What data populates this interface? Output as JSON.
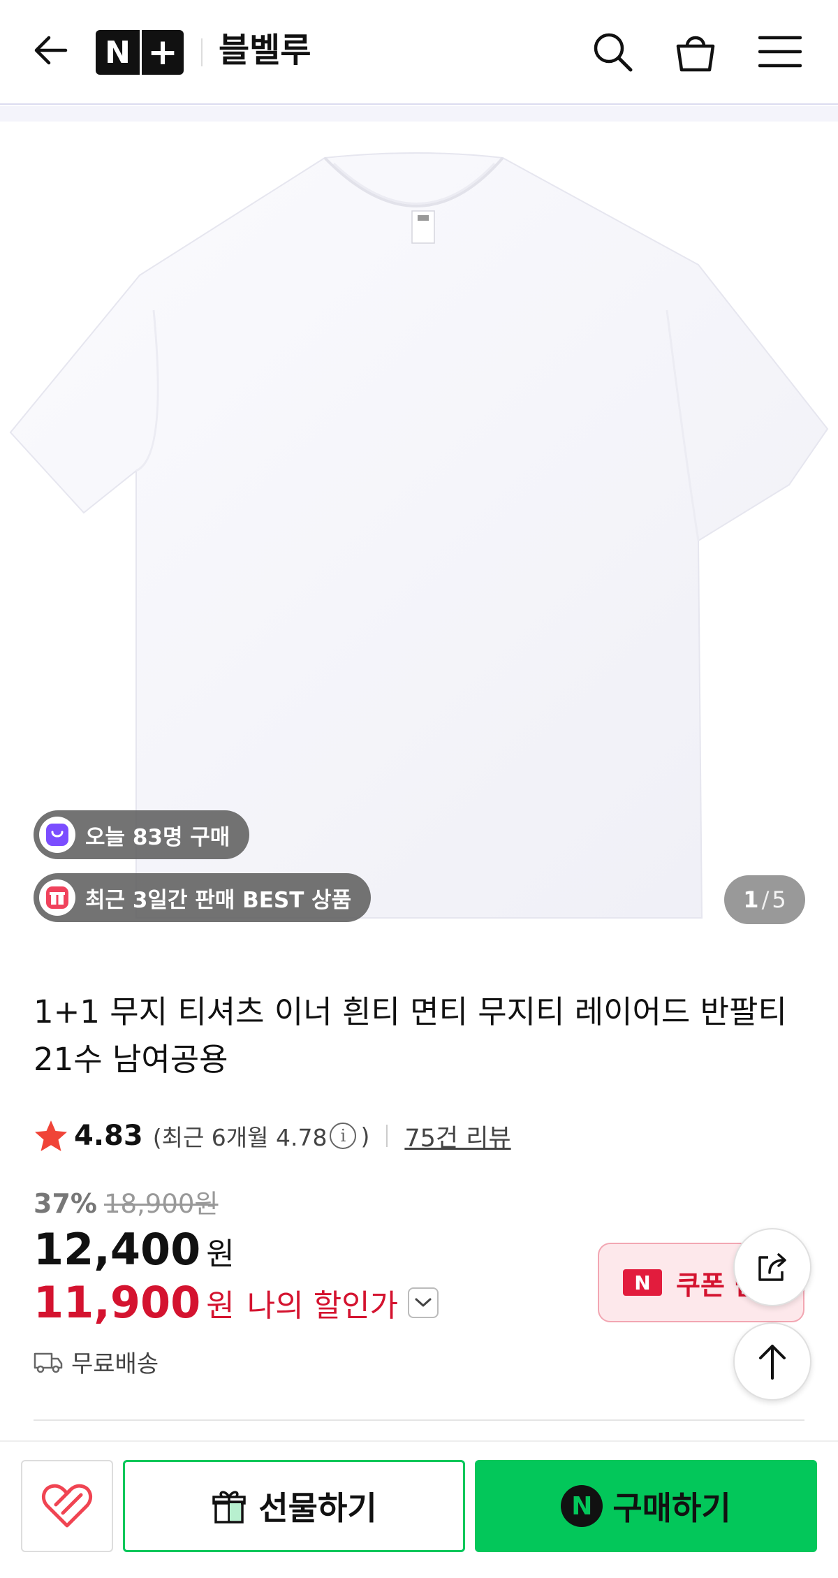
{
  "header": {
    "logo_text": "N+",
    "store_name": "블벨루"
  },
  "gallery": {
    "badges": [
      {
        "text": "오늘 83명 구매",
        "icon": "shopping-bag-icon"
      },
      {
        "text": "최근 3일간 판매 BEST 상품",
        "icon": "gift-box-icon"
      }
    ],
    "current_page": "1",
    "total_pages": "5"
  },
  "product": {
    "title": "1+1 무지 티셔츠 이너 흰티 면티 무지티 레이어드 반팔티 21수 남여공용",
    "rating": "4.83",
    "recent_rating_open": "(최근 6개월 4.78",
    "recent_rating_close": ")",
    "review_link": "75건 리뷰",
    "discount_rate": "37%",
    "original_price": "18,900원",
    "price": "12,400",
    "price_unit": "원",
    "my_discount_price": "11,900",
    "my_discount_unit": "원",
    "my_discount_label": "나의 할인가",
    "shipping": "무료배송"
  },
  "coupon": {
    "badge": "N",
    "label": "쿠폰 받"
  },
  "bottom_bar": {
    "gift_label": "선물하기",
    "buy_badge": "N",
    "buy_label": "구매하기"
  },
  "colors": {
    "naver_green": "#03c75a",
    "discount_red": "#d4132f",
    "star_red": "#f04438"
  }
}
